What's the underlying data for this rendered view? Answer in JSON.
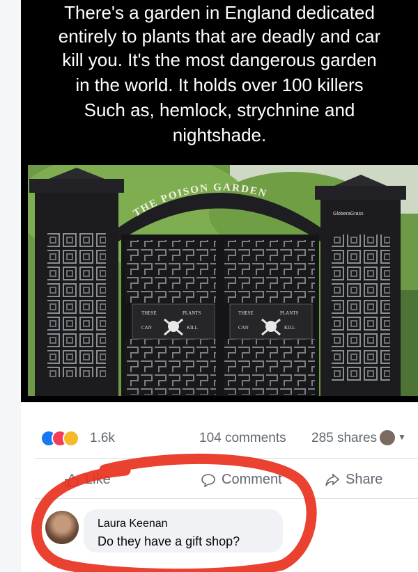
{
  "meme": {
    "lines": [
      "There's a garden in England dedicated",
      "entirely to plants that are deadly and car",
      "kill you. It's the most dangerous garden",
      "in the world. It holds over 100 killers",
      "Such as, hemlock, strychnine and",
      "nightshade."
    ]
  },
  "photo": {
    "arch_text": "THE POISON GARDEN",
    "sign_left": [
      "THESE",
      "PLANTS",
      "CAN",
      "KILL"
    ],
    "sign_right": [
      "THESE",
      "PLANTS",
      "CAN",
      "KILL"
    ],
    "watermark": "GloberaGrass"
  },
  "post_stats": {
    "reactions_count": "1.6k",
    "comments": "104 comments",
    "shares": "285 shares"
  },
  "actions": {
    "like": "Like",
    "comment": "Comment",
    "share": "Share"
  },
  "comment": {
    "author": "Laura Keenan",
    "text": "Do they have a gift shop?"
  },
  "colors": {
    "overlay_circle": "#e8311f",
    "like_blue": "#1877f2"
  }
}
